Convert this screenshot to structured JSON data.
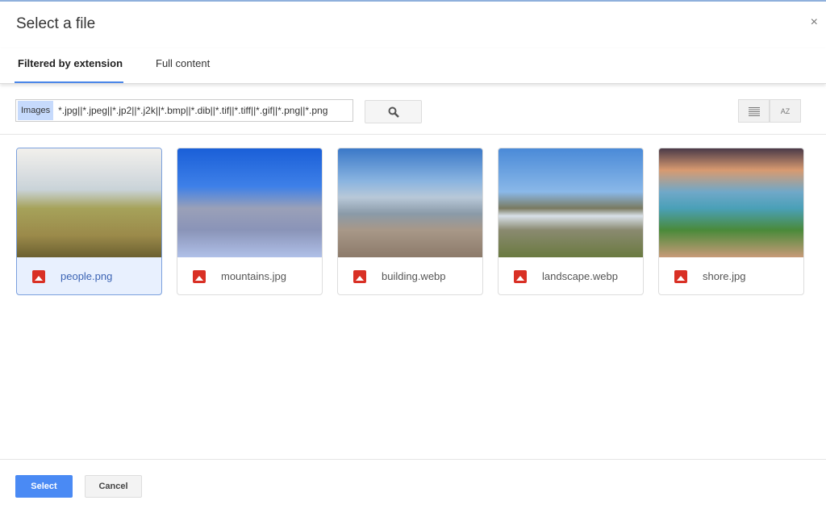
{
  "dialog": {
    "title": "Select a file",
    "close_label": "×"
  },
  "tabs": [
    {
      "label": "Filtered by extension",
      "active": true
    },
    {
      "label": "Full content",
      "active": false
    }
  ],
  "filter": {
    "chip": "Images",
    "value": "*.jpg||*.jpeg||*.jp2||*.j2k||*.bmp||*.dib||*.tif||*.tiff||*.gif||*.png||*.png"
  },
  "icons": {
    "search": "search-icon",
    "list_view": "list-view-icon",
    "sort": "sort-az-icon",
    "file": "image-file-icon"
  },
  "sort_label": "AZ",
  "files": [
    {
      "name": "people.png",
      "selected": true
    },
    {
      "name": "mountains.jpg",
      "selected": false
    },
    {
      "name": "building.webp",
      "selected": false
    },
    {
      "name": "landscape.webp",
      "selected": false
    },
    {
      "name": "shore.jpg",
      "selected": false
    }
  ],
  "footer": {
    "select": "Select",
    "cancel": "Cancel"
  },
  "colors": {
    "accent": "#4a8af4",
    "file_icon": "#d93025",
    "selected_bg": "#e8f0fe"
  }
}
